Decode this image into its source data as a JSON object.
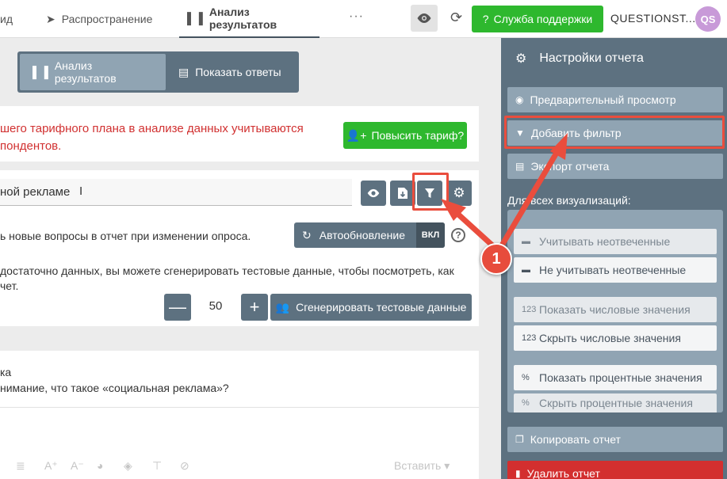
{
  "topnav": {
    "item_partial": "ид",
    "distribution": "Распространение",
    "analysis": "Анализ результатов",
    "more": "···",
    "support": "Служба поддержки",
    "account": "QUESTIONST...",
    "avatar": "QS"
  },
  "view_toggle": {
    "analysis": "Анализ результатов",
    "answers": "Показать ответы"
  },
  "plan_notice": {
    "line1": "шего тарифного плана в анализе данных учитываются",
    "line2": "пондентов.",
    "upgrade": "Повысить тариф?"
  },
  "report": {
    "title": "ной рекламе"
  },
  "autoupdate": {
    "text": "ь новые вопросы в отчет при изменении опроса.",
    "button": "Автообновление",
    "state": "ВКЛ"
  },
  "test_data": {
    "line1": "достаточно данных, вы можете сгенерировать тестовые данные, чтобы посмотреть, как",
    "line2": "чет.",
    "minus": "—",
    "value": "50",
    "plus": "+",
    "generate": "Сгенерировать тестовые данные"
  },
  "question": {
    "label": "ка",
    "text": "нимание, что такое «социальная реклама»?"
  },
  "editor": {
    "insert": "Вставить"
  },
  "panel": {
    "title": "Настройки отчета",
    "preview": "Предварительный просмотр",
    "add_filter": "Добавить фильтр",
    "export": "Экспорт отчета",
    "all_vis": "Для всех визуализаций:",
    "count_unanswered": "Учитывать неотвеченные",
    "ignore_unanswered": "Не учитывать неотвеченные",
    "show_numbers": "Показать числовые значения",
    "hide_numbers": "Скрыть числовые значения",
    "show_percent": "Показать процентные значения",
    "hide_percent": "Скрыть процентные значения",
    "copy": "Копировать отчет",
    "delete": "Удалить отчет"
  },
  "annotation": {
    "step": "1"
  }
}
